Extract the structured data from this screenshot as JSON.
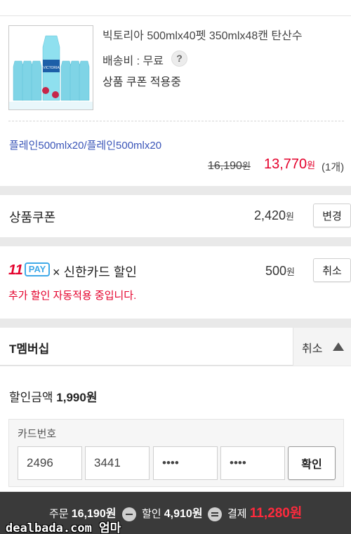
{
  "product": {
    "name": "빅토리아 500mlx40펫 350mlx48캔 탄산수",
    "shipping": "배송비 : 무료",
    "help_icon": "?",
    "coupon_status": "상품 쿠폰 적용중",
    "option": "플레인500mlx20/플레인500mlx20",
    "original_price": "16,190",
    "sale_price": "13,770",
    "won": "원",
    "quantity": "(1개)",
    "bottle_label": "VICTORIA"
  },
  "coupon": {
    "label": "상품쿠폰",
    "amount": "2,420",
    "won": "원",
    "button": "변경"
  },
  "card_discount": {
    "pay_brand_num": "11",
    "pay_brand_text": "PAY",
    "label": "× 신한카드 할인",
    "amount": "500",
    "won": "원",
    "button": "취소",
    "notice": "추가 할인 자동적용 중입니다."
  },
  "tmembership": {
    "title": "T멤버십",
    "toggle_label": "취소",
    "discount_label": "할인금액",
    "discount_amount": "1,990원",
    "card_label": "카드번호",
    "card_fields": [
      "2496",
      "3441",
      "••••",
      "••••"
    ],
    "confirm_button": "확인"
  },
  "summary": {
    "order_label": "주문",
    "order_amount": "16,190원",
    "discount_label": "할인",
    "discount_amount": "4,910원",
    "pay_label": "결제",
    "pay_amount": "11,280원"
  },
  "watermark": "dealbada.com 엄마",
  "colors": {
    "accent_red": "#e4002b",
    "option_blue": "#3a55b8",
    "pay_blue": "#3fa9e8",
    "bottom_bar": "#3a3a3a"
  }
}
